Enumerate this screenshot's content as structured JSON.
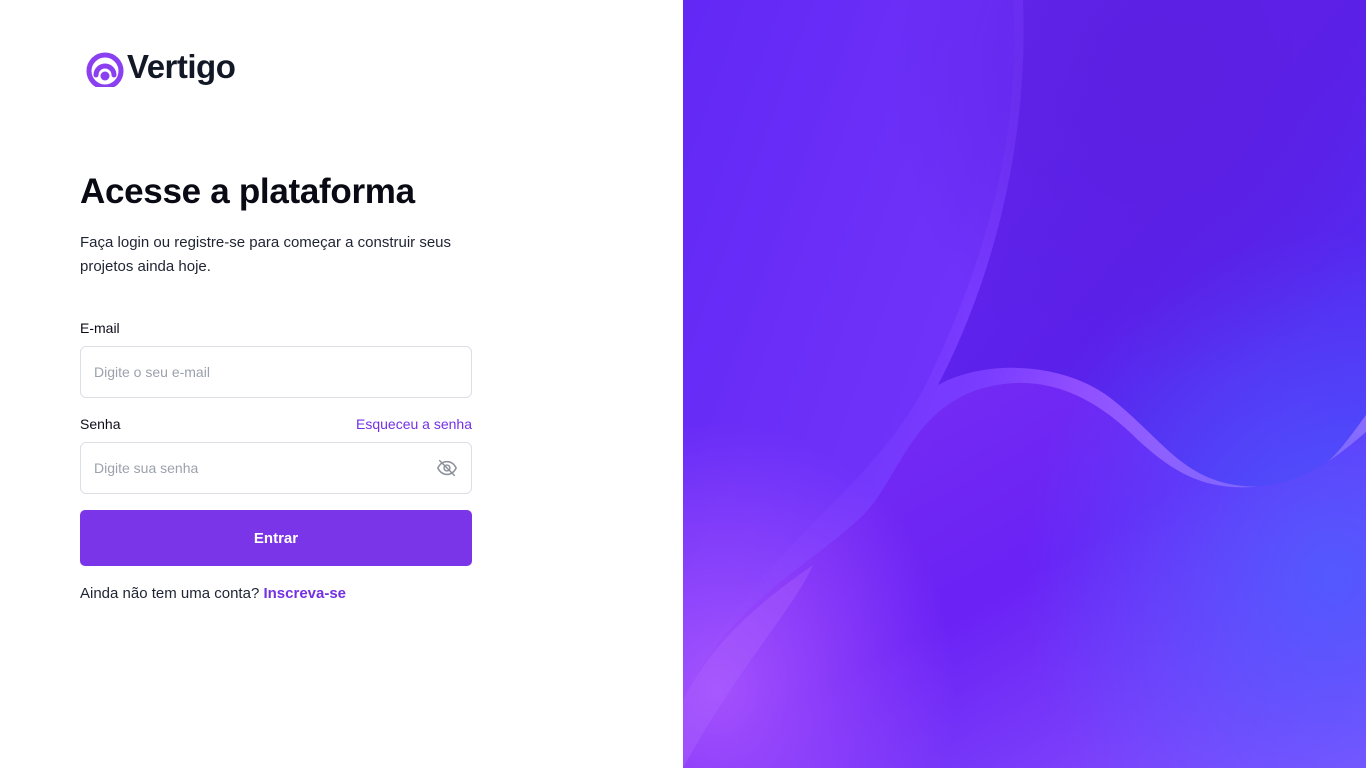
{
  "brand": {
    "name": "Vertigo",
    "accent": "#7b35e8",
    "logo_icon": "vertigo-logo-icon"
  },
  "heading": {
    "title": "Acesse a plataforma",
    "subtitle": "Faça login ou registre-se para começar a construir seus projetos ainda hoje."
  },
  "form": {
    "email_label": "E-mail",
    "email_placeholder": "Digite o seu e-mail",
    "email_value": "",
    "password_label": "Senha",
    "forgot_label": "Esqueceu a senha",
    "password_placeholder": "Digite sua senha",
    "password_value": "",
    "password_toggle_icon": "eye-off-icon",
    "submit_label": "Entrar"
  },
  "signup": {
    "prompt": "Ainda não tem uma conta?",
    "link_label": "Inscreva-se"
  },
  "colors": {
    "background_gradient": [
      "#5a1fe6",
      "#a35cff",
      "#6a2cf0",
      "#4a3dff"
    ],
    "link": "#7431e4"
  }
}
